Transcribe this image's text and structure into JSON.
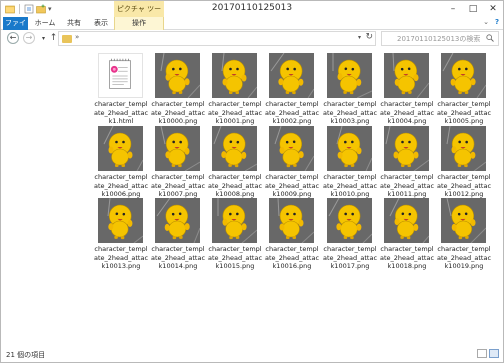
{
  "window": {
    "title": "20170110125013"
  },
  "ribbon": {
    "context_tool": "ピクチャ ツール",
    "tabs": [
      "ファイル",
      "ホーム",
      "共有",
      "表示",
      "操作"
    ]
  },
  "address": {
    "path_chevron": "»",
    "search_placeholder": "20170110125013の検索"
  },
  "files": [
    {
      "name": "character_template_2head_attack1.html",
      "type": "html"
    },
    {
      "name": "character_template_2head_attack10000.png",
      "type": "png"
    },
    {
      "name": "character_template_2head_attack10001.png",
      "type": "png"
    },
    {
      "name": "character_template_2head_attack10002.png",
      "type": "png"
    },
    {
      "name": "character_template_2head_attack10003.png",
      "type": "png"
    },
    {
      "name": "character_template_2head_attack10004.png",
      "type": "png"
    },
    {
      "name": "character_template_2head_attack10005.png",
      "type": "png"
    },
    {
      "name": "character_template_2head_attack10006.png",
      "type": "png"
    },
    {
      "name": "character_template_2head_attack10007.png",
      "type": "png"
    },
    {
      "name": "character_template_2head_attack10008.png",
      "type": "png"
    },
    {
      "name": "character_template_2head_attack10009.png",
      "type": "png"
    },
    {
      "name": "character_template_2head_attack10010.png",
      "type": "png"
    },
    {
      "name": "character_template_2head_attack10011.png",
      "type": "png"
    },
    {
      "name": "character_template_2head_attack10012.png",
      "type": "png"
    },
    {
      "name": "character_template_2head_attack10013.png",
      "type": "png"
    },
    {
      "name": "character_template_2head_attack10014.png",
      "type": "png"
    },
    {
      "name": "character_template_2head_attack10015.png",
      "type": "png"
    },
    {
      "name": "character_template_2head_attack10016.png",
      "type": "png"
    },
    {
      "name": "character_template_2head_attack10017.png",
      "type": "png"
    },
    {
      "name": "character_template_2head_attack10018.png",
      "type": "png"
    },
    {
      "name": "character_template_2head_attack10019.png",
      "type": "png"
    }
  ],
  "status": {
    "item_count": "21 個の項目"
  },
  "colors": {
    "file_tab": "#1979ca",
    "context_tab": "#f9e8a8",
    "thumb_bg": "#686868",
    "character": "#f5c400"
  }
}
